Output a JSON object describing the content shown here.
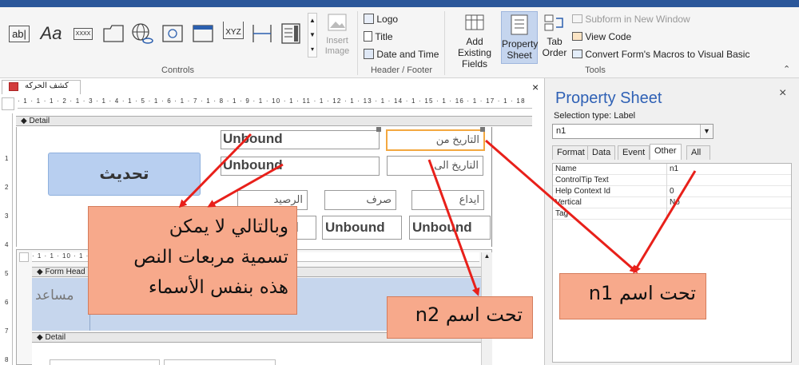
{
  "ribbon": {
    "controls_group_label": "Controls",
    "header_footer_group_label": "Header / Footer",
    "tools_group_label": "Tools",
    "insert_image_line1": "Insert",
    "insert_image_line2": "Image",
    "logo_label": "Logo",
    "title_label": "Title",
    "date_time_label": "Date and Time",
    "add_existing_line1": "Add Existing",
    "add_existing_line2": "Fields",
    "property_sheet_line1": "Property",
    "property_sheet_line2": "Sheet",
    "tab_order_line1": "Tab",
    "tab_order_line2": "Order",
    "subform_label": "Subform in New Window",
    "view_code_label": "View Code",
    "convert_macros_label": "Convert Form's Macros to Visual Basic",
    "textbox_icon_text": "ab|",
    "label_icon_text": "Aa",
    "button_icon_text": "XXXX",
    "xyz_icon_text": "XYZ"
  },
  "document": {
    "tab_title": "كشف الحركه",
    "close_glyph": "×",
    "detail_section": "Detail",
    "form_header_section": "Form Head",
    "detail_section_2": "Detail",
    "update_button": "تحديث",
    "fields": {
      "unbound_1": "Unbound",
      "unbound_2": "Unbound",
      "unbound_3": "Unbound",
      "unbound_4": "Unbound",
      "unbound_5": "Unbound"
    },
    "labels": {
      "date_from": "التاريخ من",
      "date_to": "التاريخ الى",
      "balance": "الرصيد",
      "expense": "صرف",
      "deposit": "ايداع",
      "helper": "مساعد"
    },
    "ruler_top": "· 1 · 1 · 1 · 2 · 1 · 3 · 1 · 4 · 1 · 5 · 1 · 6 · 1 · 7 · 1 · 8 · 1 · 9 · 1 · 10 · 1 · 11 · 1 · 12 · 1 · 13 · 1 · 14 · 1 · 15 · 1 · 16 · 1 · 17 · 1 · 18",
    "ruler_sub": "· 1 · 1 · 10 · 1 · 11 · 1 · 12 · 1 · 13 · 1 · 14 · 1 · 15"
  },
  "property_sheet": {
    "title": "Property Sheet",
    "close_glyph": "×",
    "selection_type": "Selection type:  Label",
    "selected_object": "n1",
    "tabs": [
      "Format",
      "Data",
      "Event",
      "Other",
      "All"
    ],
    "active_tab": "Other",
    "rows": [
      {
        "name": "Name",
        "value": "n1"
      },
      {
        "name": "ControlTip Text",
        "value": ""
      },
      {
        "name": "Help Context Id",
        "value": "0"
      },
      {
        "name": "Vertical",
        "value": "No"
      },
      {
        "name": "Tag",
        "value": ""
      }
    ]
  },
  "annotations": {
    "callout_main_1": "وبالتالي لا يمكن",
    "callout_main_2": "تسمية مربعات النص",
    "callout_main_3": "هذه بنفس الأسماء",
    "callout_n2": "تحت اسم  n2",
    "callout_n1": "تحت اسم  n1"
  },
  "colors": {
    "accent": "#2f61b5",
    "callout_fill": "#f7a98b",
    "arrow": "#e8201a",
    "selection": "#f3a840"
  }
}
